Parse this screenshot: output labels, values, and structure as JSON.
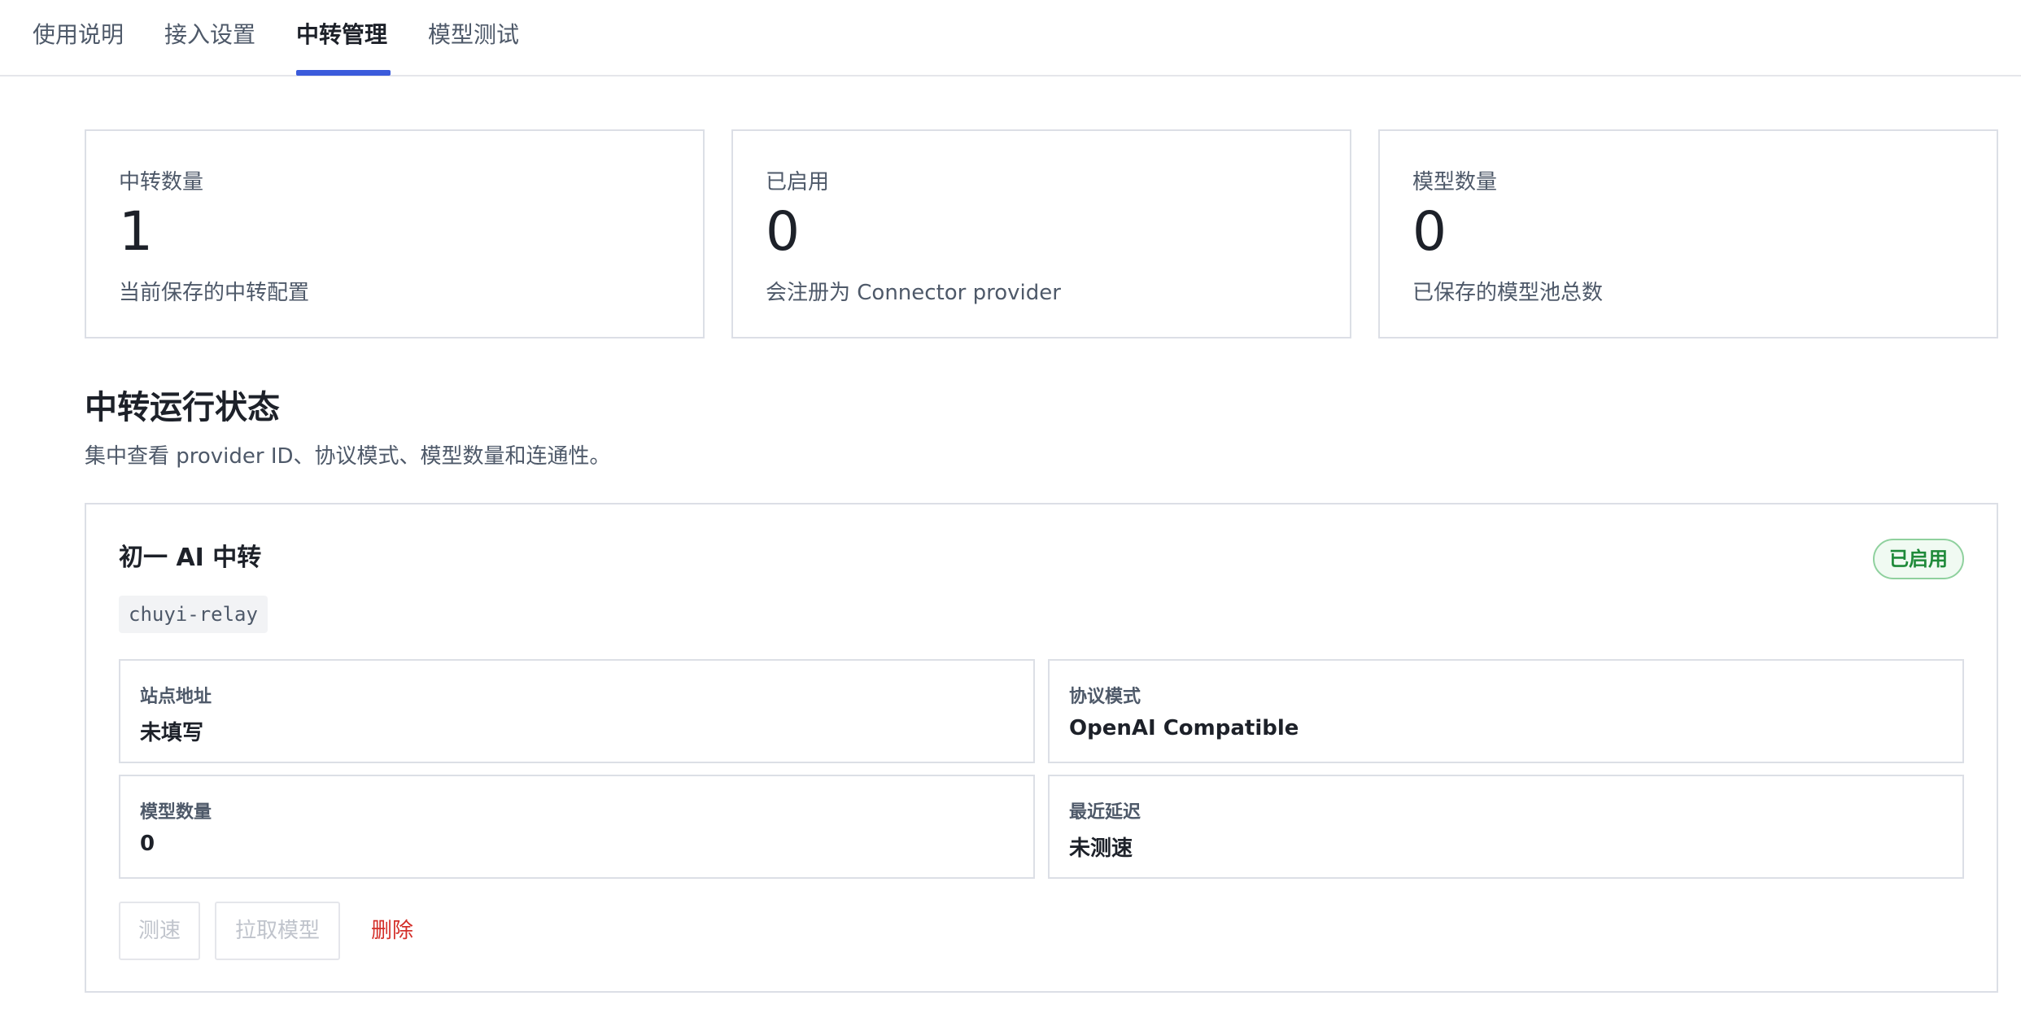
{
  "tabs": [
    {
      "label": "使用说明"
    },
    {
      "label": "接入设置"
    },
    {
      "label": "中转管理",
      "active": true
    },
    {
      "label": "模型测试"
    }
  ],
  "stats": [
    {
      "label": "中转数量",
      "value": "1",
      "desc": "当前保存的中转配置"
    },
    {
      "label": "已启用",
      "value": "0",
      "desc": "会注册为 Connector provider"
    },
    {
      "label": "模型数量",
      "value": "0",
      "desc": "已保存的模型池总数"
    }
  ],
  "section": {
    "title": "中转运行状态",
    "subtitle": "集中查看 provider ID、协议模式、模型数量和连通性。"
  },
  "relay": {
    "name": "初一 AI 中转",
    "status_badge": "已启用",
    "id": "chuyi-relay",
    "fields": [
      {
        "label": "站点地址",
        "value": "未填写"
      },
      {
        "label": "协议模式",
        "value": "OpenAI Compatible"
      },
      {
        "label": "模型数量",
        "value": "0"
      },
      {
        "label": "最近延迟",
        "value": "未测速"
      }
    ],
    "actions": {
      "speed_test": "测速",
      "fetch_models": "拉取模型",
      "delete": "删除"
    }
  },
  "colors": {
    "accent": "#3b5bdb",
    "success": "#1f8a3a",
    "danger": "#d4302a"
  }
}
